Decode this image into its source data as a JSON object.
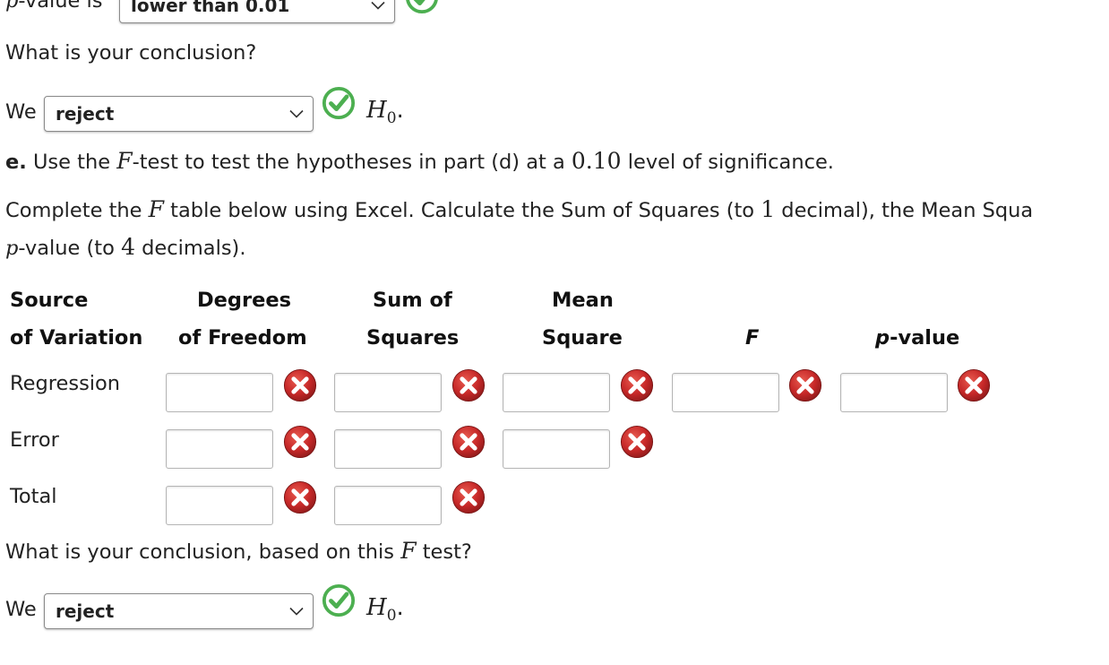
{
  "top": {
    "pvalue_prefix_var": "p",
    "pvalue_prefix_text": "-value is",
    "pvalue_select": "lower than 0.01"
  },
  "conclusion1": {
    "question": "What is your conclusion?",
    "we": "We",
    "select": "reject",
    "h0": "H",
    "h0_sub": "0",
    "period": "."
  },
  "part_e": {
    "letter": "e.",
    "text_a": " Use the ",
    "f": "F",
    "text_b": "-test to test the hypotheses in part (d) at a ",
    "alpha": "0.10",
    "text_c": " level of significance."
  },
  "instructions": {
    "text_a": "Complete the ",
    "f": "F",
    "text_b": " table below using Excel. Calculate the Sum of Squares (to ",
    "num1": "1",
    "text_c": " decimal), the Mean Squa",
    "line2_p": "p",
    "line2_a": "-value (to ",
    "num4": "4",
    "line2_b": " decimals)."
  },
  "table": {
    "headers": {
      "source_1": "Source",
      "source_2": "of Variation",
      "df_1": "Degrees",
      "df_2": "of Freedom",
      "ss_1": "Sum of",
      "ss_2": "Squares",
      "ms_1": "Mean",
      "ms_2": "Square",
      "f": "F",
      "pval_p": "p",
      "pval_rest": "-value"
    },
    "rows": [
      {
        "label": "Regression"
      },
      {
        "label": "Error"
      },
      {
        "label": "Total"
      }
    ]
  },
  "conclusion2": {
    "question_a": "What is your conclusion, based on this ",
    "f": "F",
    "question_b": " test?",
    "we": "We",
    "select": "reject",
    "h0": "H",
    "h0_sub": "0",
    "period": "."
  },
  "colors": {
    "correct_green": "#4caf50",
    "wrong_red": "#c62828"
  },
  "icons": {
    "correct": "check-circle-icon",
    "incorrect": "x-circle-icon",
    "dropdown": "chevron-down-icon"
  }
}
